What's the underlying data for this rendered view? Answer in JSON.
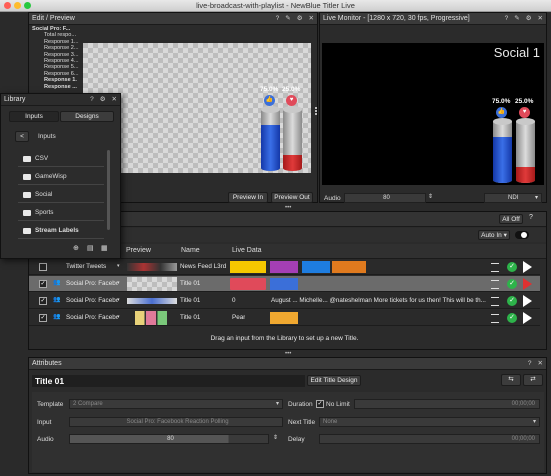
{
  "window": {
    "title": "live-broadcast-with-playlist - NewBlue Titler Live"
  },
  "edit_preview": {
    "title": "Edit / Preview",
    "tree": [
      "Social Pro: F...",
      "Total respo...",
      "Response 1...",
      "Response 2...",
      "Response 3...",
      "Response 4...",
      "Response 5...",
      "Response 6...",
      "Response 1.",
      "Response ..."
    ],
    "poll": {
      "left_pct": "75.0%",
      "right_pct": "25.0%",
      "left_fill": 0.75,
      "right_fill": 0.25
    },
    "preview_in": "Preview In",
    "preview_out": "Preview Out"
  },
  "live_monitor": {
    "title": "Live Monitor - [1280 x 720, 30 fps, Progressive]",
    "overlay_title": "Social 1",
    "poll": {
      "left_pct": "75.0%",
      "right_pct": "25.0%"
    },
    "audio_label": "Audio",
    "audio_value": "80",
    "output": "NDI"
  },
  "library": {
    "title": "Library",
    "tabs": [
      "Inputs",
      "Designs"
    ],
    "back": "<",
    "heading": "Inputs",
    "items": [
      "CSV",
      "GameWisp",
      "Social",
      "Sports",
      "Stream Labels"
    ]
  },
  "playlist": {
    "all_off": "All Off",
    "auto_in": "Auto In",
    "columns": [
      "Preview",
      "Name",
      "Live Data"
    ],
    "rows": [
      {
        "checked": false,
        "source": "Twitter Tweets",
        "name": "News Feed L3rd",
        "data": "",
        "extra": ""
      },
      {
        "checked": true,
        "source": "Social Pro: Facebo...",
        "name": "Title 01",
        "data": "",
        "extra": ""
      },
      {
        "checked": true,
        "source": "Social Pro: Facebo...",
        "name": "Title 01",
        "data": "0",
        "extra": "August ...  Michelle...  @nateshelman More tickets for us then! This will be th..."
      },
      {
        "checked": true,
        "source": "Social Pro: Facebo...",
        "name": "Title 01",
        "data": "Pear",
        "extra": ""
      }
    ],
    "drag_hint": "Drag an input from the Library to set up a new Title."
  },
  "attributes": {
    "title": "Attributes",
    "title_name": "Title 01",
    "edit_design": "Edit Title Design",
    "template_label": "Template",
    "template_value": "2 Compare",
    "duration_label": "Duration",
    "no_limit": "No Limit",
    "duration_value": "00;00;00",
    "input_label": "Input",
    "input_value": "Social Pro: Facebook Reaction Polling",
    "next_title_label": "Next Title",
    "next_title_value": "None",
    "audio_label": "Audio",
    "audio_value": "80",
    "delay_label": "Delay",
    "delay_value": "00;00;00"
  },
  "colors": {
    "accent": "#2f6fd6",
    "play_red": "#e03030",
    "check_green": "#2db34a"
  }
}
